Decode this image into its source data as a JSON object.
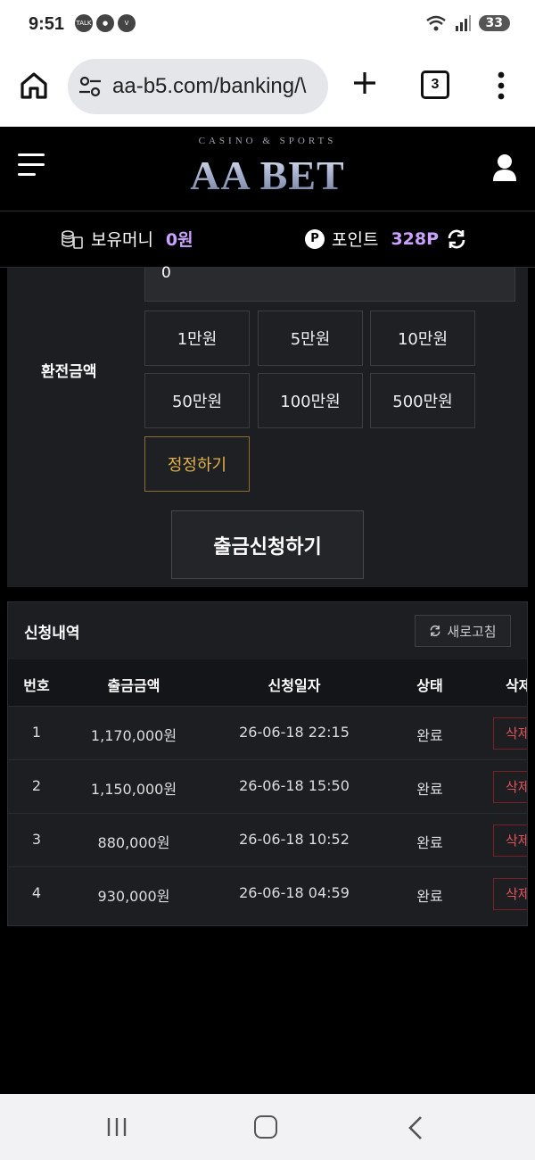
{
  "status_bar": {
    "time": "9:51",
    "notifications": [
      "TALK",
      "chat",
      "V"
    ],
    "battery": "33"
  },
  "browser": {
    "url": "aa-b5.com/banking/\\",
    "tab_count": "3"
  },
  "site": {
    "logo_sub": "CASINO & SPORTS",
    "logo_main": "AA BET"
  },
  "money_bar": {
    "balance_label": "보유머니",
    "balance_value": "0원",
    "points_badge": "P",
    "points_label": "포인트",
    "points_value": "328P"
  },
  "form": {
    "amount_value": "0",
    "label": "환전금액",
    "amount_buttons": [
      "1만원",
      "5만원",
      "10만원",
      "50만원",
      "100만원",
      "500만원"
    ],
    "reset_label": "정정하기",
    "submit_label": "출금신청하기"
  },
  "history": {
    "title": "신청내역",
    "refresh_label": "새로고침",
    "columns": [
      "번호",
      "출금금액",
      "신청일자",
      "상태",
      "삭제"
    ],
    "rows": [
      {
        "no": "1",
        "amount": "1,170,000원",
        "date": "26-06-18 22:15",
        "status": "완료",
        "action": "삭제"
      },
      {
        "no": "2",
        "amount": "1,150,000원",
        "date": "26-06-18 15:50",
        "status": "완료",
        "action": "삭제"
      },
      {
        "no": "3",
        "amount": "880,000원",
        "date": "26-06-18 10:52",
        "status": "완료",
        "action": "삭제"
      },
      {
        "no": "4",
        "amount": "930,000원",
        "date": "26-06-18 04:59",
        "status": "완료",
        "action": "삭제"
      }
    ]
  },
  "colors": {
    "accent_value": "#c9a3ff",
    "reset_gold": "#e0b247",
    "delete_red": "#e0545a",
    "panel_bg": "#1d1e22"
  },
  "icons": {
    "home": "home-icon",
    "tune": "site-settings-icon",
    "plus": "plus-icon",
    "menu": "more-vert-icon",
    "hamburger": "hamburger-menu-icon",
    "user": "user-icon",
    "coins": "coins-icon",
    "refresh": "refresh-icon"
  }
}
